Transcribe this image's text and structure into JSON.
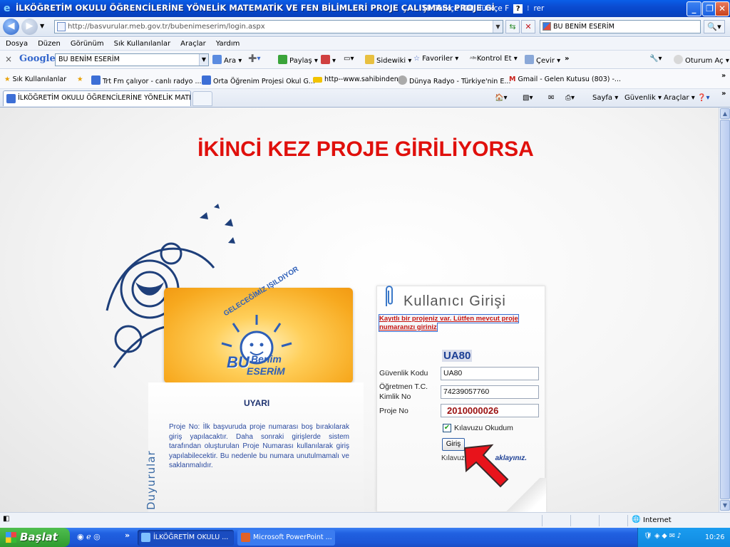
{
  "window": {
    "title": "İLKÖĞRETİM OKULU ÖĞRENCİLERİNE YÖNELİK MATEMATİK VE FEN BİLİMLERİ PROJE ÇALIŞMASI PROJE Gİ",
    "lang1": "TR Türkçe",
    "lang2": "Türkçe F",
    "lang_tail": "rer"
  },
  "address": {
    "url": "http://basvurular.meb.gov.tr/bubenimeserim/login.aspx",
    "search_value": "BU BENİM ESERİM"
  },
  "menu": [
    "Dosya",
    "Düzen",
    "Görünüm",
    "Sık Kullanılanlar",
    "Araçlar",
    "Yardım"
  ],
  "google_toolbar": {
    "logo": "Google",
    "query": "BU BENİM ESERİM",
    "items": [
      "Ara",
      "Paylaş",
      "Sidewiki",
      "Favoriler",
      "Kontrol Et",
      "Çevir",
      "Oturum Aç"
    ]
  },
  "favorites": {
    "label": "Sık Kullanılanlar",
    "items": [
      "Trt Fm çalıyor - canlı radyo ...",
      "Orta Öğrenim Projesi Okul G...",
      "http--www.sahibinden",
      "Dünya Radyo - Türkiye'nin E...",
      "Gmail - Gelen Kutusu (803) -..."
    ]
  },
  "tab": {
    "title": "İLKÖĞRETİM OKULU ÖĞRENCİLERİNE YÖNELİK MATE...",
    "commands": [
      "Sayfa",
      "Güvenlik",
      "Araçlar"
    ]
  },
  "page": {
    "headline": "İKİNCİ KEZ PROJE GİRİLİYORSA",
    "side_tab": "Duyurular",
    "uyari_title": "UYARI",
    "notice": "Proje No: İlk başvuruda proje numarası boş bırakılarak giriş yapılacaktır. Daha sonraki girişlerde sistem tarafından oluşturulan Proje Numarası kullanılarak giriş yapılabilecektir. Bu nedenle bu numara unutulmamalı ve saklanmalıdır.",
    "logo_arc": "GELECEĞİMİZ IŞILDIYOR",
    "logo_line1": "BU",
    "logo_line2": "Benim",
    "logo_line3": "ESERİM"
  },
  "login": {
    "title": "Kullanıcı Girişi",
    "warning": "Kayıtlı bir projeniz var. Lütfen mevcut proje numaranızı giriniz",
    "captcha": "UA80",
    "security_label": "Güvenlik Kodu",
    "security_value": "UA80",
    "tc_label_1": "Öğretmen T.C.",
    "tc_label_2": "Kimlik No",
    "tc_value": "74239057760",
    "project_label": "Proje No",
    "project_value": "2010000026",
    "guide_checked_label": "Kılavuzu Okudum",
    "submit": "Giriş",
    "guide_prefix": "Kılavuz",
    "guide_link": "aklayınız."
  },
  "status": {
    "zone": "Internet"
  },
  "taskbar": {
    "start": "Başlat",
    "buttons": [
      "İLKÖĞRETİM OKULU ...",
      "Microsoft PowerPoint ..."
    ],
    "clock": "10:26"
  },
  "colors": {
    "headline": "#e0100c",
    "warning": "#c8140e",
    "project_no": "#9b1010",
    "arrow": "#e8131b"
  }
}
